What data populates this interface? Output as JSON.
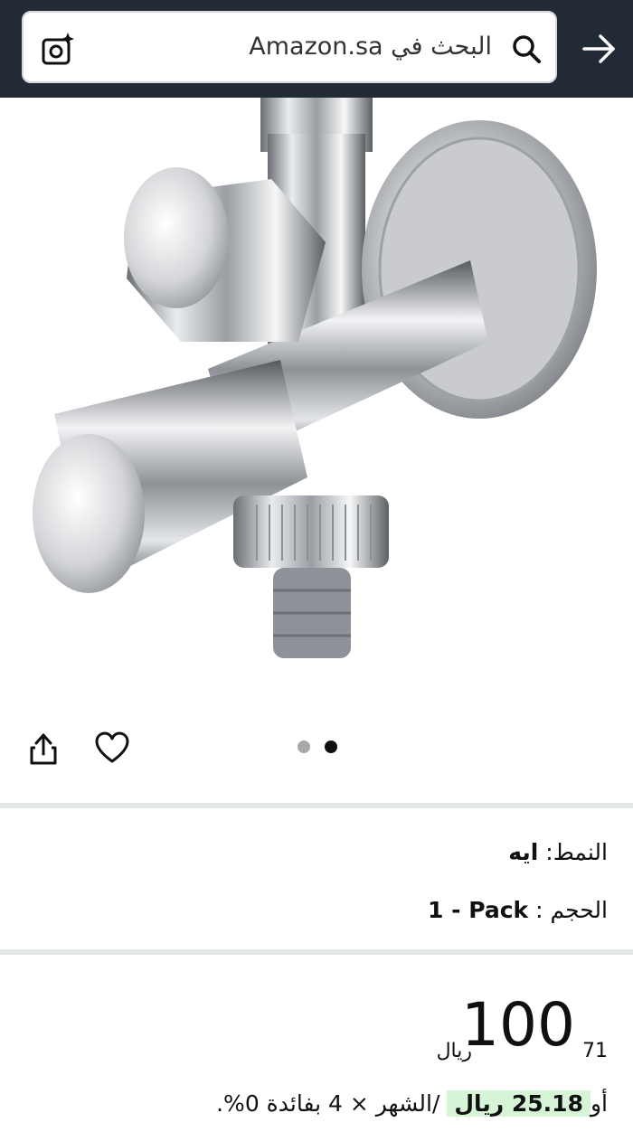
{
  "search": {
    "placeholder": "البحث في Amazon.sa"
  },
  "product": {
    "image_dots": {
      "count": 2,
      "active_index": 1
    },
    "style_label": "النمط:",
    "style_value": "ايه",
    "size_label": "الحجم :",
    "size_value": "1 - Pack",
    "price_whole": "100",
    "price_fraction": "71",
    "currency": "ريال",
    "installment_prefix": "أو",
    "installment_amount": "25.18 ريال",
    "installment_text": " /الشهر × 4 بفائدة 0%."
  },
  "colors": {
    "header_bg": "#222a35",
    "installment_highlight": "#d6f5d6"
  }
}
